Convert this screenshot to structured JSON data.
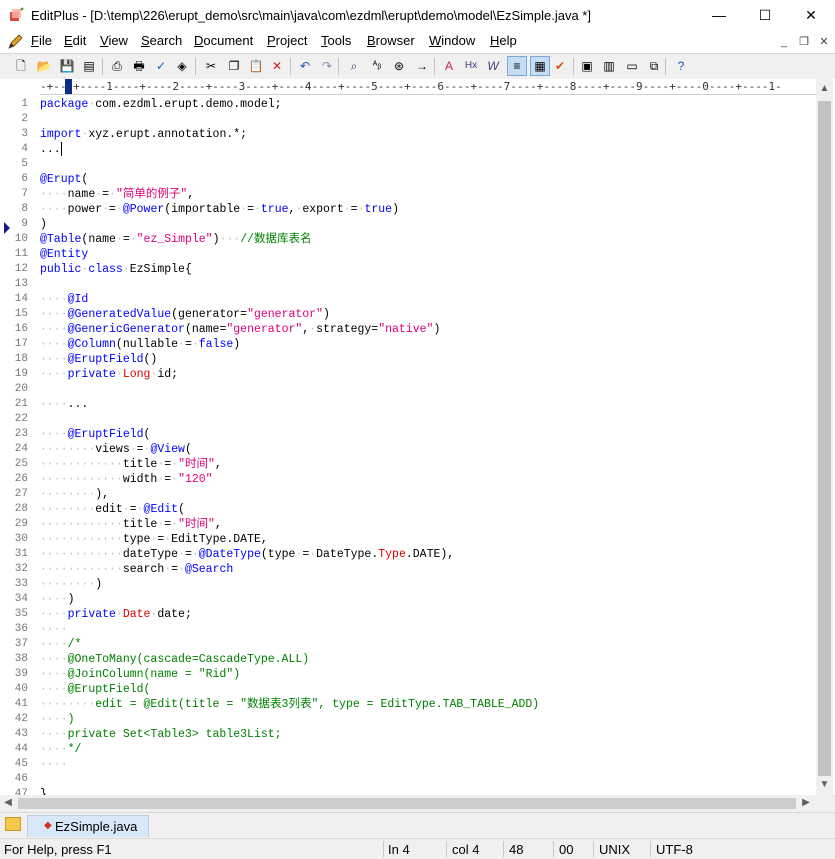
{
  "window": {
    "title": "EditPlus - [D:\\temp\\226\\erupt_demo\\src\\main\\java\\com\\ezdml\\erupt\\demo\\model\\EzSimple.java *]",
    "minimize_glyph": "—",
    "maximize_glyph": "☐",
    "close_glyph": "✕"
  },
  "menu": {
    "items": [
      {
        "hot": "F",
        "rest": "ile"
      },
      {
        "hot": "E",
        "rest": "dit"
      },
      {
        "hot": "V",
        "rest": "iew"
      },
      {
        "hot": "S",
        "rest": "earch"
      },
      {
        "hot": "D",
        "rest": "ocument"
      },
      {
        "hot": "P",
        "rest": "roject"
      },
      {
        "hot": "T",
        "rest": "ools"
      },
      {
        "hot": "B",
        "rest": "rowser"
      },
      {
        "hot": "W",
        "rest": "indow"
      },
      {
        "hot": "H",
        "rest": "elp"
      }
    ],
    "mdi_minimize": "_",
    "mdi_restore": "❐",
    "mdi_close": "✕"
  },
  "toolbar": {
    "icons": [
      "new-file-icon",
      "open-file-icon",
      "save-icon",
      "save-all-icon",
      "print-preview-icon",
      "print-icon",
      "spell-check-icon",
      "browser-preview-icon",
      "cut-icon",
      "copy-icon",
      "paste-icon",
      "delete-icon",
      "undo-icon",
      "redo-icon",
      "find-icon",
      "replace-icon",
      "find-in-files-icon",
      "go-to-icon",
      "font-icon",
      "hx-icon",
      "word-wrap-w-icon",
      "wrap-icon",
      "column-select-icon",
      "check-icon",
      "cliptext-icon",
      "directory-icon",
      "output-window-icon",
      "toggle-window-icon",
      "context-help-icon"
    ],
    "active": [
      "wrap-icon",
      "column-select-icon"
    ]
  },
  "editor": {
    "ruler": "-+---+----1----+----2----+----3----+----4----+----5----+----6----+----7----+----8----+----9----+----0----+----1-",
    "current_line": 4,
    "line_numbers": [
      "1",
      "2",
      "3",
      "4",
      "5",
      "6",
      "7",
      "8",
      "9",
      "10",
      "11",
      "12",
      "13",
      "14",
      "15",
      "16",
      "17",
      "18",
      "19",
      "20",
      "21",
      "22",
      "23",
      "24",
      "25",
      "26",
      "27",
      "28",
      "29",
      "30",
      "31",
      "32",
      "33",
      "34",
      "35",
      "36",
      "37",
      "38",
      "39",
      "40",
      "41",
      "42",
      "43",
      "44",
      "45",
      "46",
      "47"
    ],
    "lines": [
      [
        [
          "k",
          "package"
        ],
        [
          "d",
          "·"
        ],
        [
          "",
          "com.ezdml.erupt.demo.model;"
        ]
      ],
      [],
      [
        [
          "k",
          "import"
        ],
        [
          "d",
          "·"
        ],
        [
          "",
          "xyz.erupt.annotation.*;"
        ]
      ],
      [
        [
          "",
          "..."
        ],
        [
          "caret",
          ""
        ]
      ],
      [],
      [
        [
          "a",
          "@Erupt"
        ],
        [
          "",
          "("
        ]
      ],
      [
        [
          "d",
          "····"
        ],
        [
          "",
          "name"
        ],
        [
          "d",
          "·"
        ],
        [
          "",
          "="
        ],
        [
          "d",
          "·"
        ],
        [
          "s",
          "\"简单的例子\""
        ],
        [
          "",
          ","
        ]
      ],
      [
        [
          "d",
          "····"
        ],
        [
          "",
          "power"
        ],
        [
          "d",
          "·"
        ],
        [
          "",
          "="
        ],
        [
          "d",
          "·"
        ],
        [
          "a",
          "@Power"
        ],
        [
          "",
          "(importable"
        ],
        [
          "d",
          "·"
        ],
        [
          "",
          "="
        ],
        [
          "d",
          "·"
        ],
        [
          "k",
          "true"
        ],
        [
          "",
          ","
        ],
        [
          "d",
          "·"
        ],
        [
          "",
          "export"
        ],
        [
          "d",
          "·"
        ],
        [
          "",
          "="
        ],
        [
          "d",
          "·"
        ],
        [
          "k",
          "true"
        ],
        [
          "",
          ")"
        ]
      ],
      [
        [
          "",
          ")"
        ]
      ],
      [
        [
          "a",
          "@Table"
        ],
        [
          "",
          "(name"
        ],
        [
          "d",
          "·"
        ],
        [
          "",
          "="
        ],
        [
          "d",
          "·"
        ],
        [
          "s",
          "\"ez_Simple\""
        ],
        [
          "",
          ")"
        ],
        [
          "d",
          "···"
        ],
        [
          "c",
          "//数据库表名"
        ]
      ],
      [
        [
          "a",
          "@Entity"
        ]
      ],
      [
        [
          "k",
          "public"
        ],
        [
          "d",
          "·"
        ],
        [
          "k",
          "class"
        ],
        [
          "d",
          "·"
        ],
        [
          "",
          "EzSimple{"
        ]
      ],
      [],
      [
        [
          "d",
          "····"
        ],
        [
          "a",
          "@Id"
        ]
      ],
      [
        [
          "d",
          "····"
        ],
        [
          "a",
          "@GeneratedValue"
        ],
        [
          "",
          "(generator="
        ],
        [
          "s",
          "\"generator\""
        ],
        [
          "",
          ")"
        ]
      ],
      [
        [
          "d",
          "····"
        ],
        [
          "a",
          "@GenericGenerator"
        ],
        [
          "",
          "(name="
        ],
        [
          "s",
          "\"generator\""
        ],
        [
          "",
          ","
        ],
        [
          "d",
          "·"
        ],
        [
          "",
          "strategy="
        ],
        [
          "s",
          "\"native\""
        ],
        [
          "",
          ")"
        ]
      ],
      [
        [
          "d",
          "····"
        ],
        [
          "a",
          "@Column"
        ],
        [
          "",
          "(nullable"
        ],
        [
          "d",
          "·"
        ],
        [
          "",
          "="
        ],
        [
          "d",
          "·"
        ],
        [
          "k",
          "false"
        ],
        [
          "",
          ")"
        ]
      ],
      [
        [
          "d",
          "····"
        ],
        [
          "a",
          "@EruptField"
        ],
        [
          "",
          "()"
        ]
      ],
      [
        [
          "d",
          "····"
        ],
        [
          "k",
          "private"
        ],
        [
          "d",
          "·"
        ],
        [
          "t",
          "Long"
        ],
        [
          "d",
          "·"
        ],
        [
          "",
          "id;"
        ]
      ],
      [],
      [
        [
          "d",
          "····"
        ],
        [
          "",
          "..."
        ]
      ],
      [],
      [
        [
          "d",
          "····"
        ],
        [
          "a",
          "@EruptField"
        ],
        [
          "",
          "("
        ]
      ],
      [
        [
          "d",
          "········"
        ],
        [
          "",
          "views"
        ],
        [
          "d",
          "·"
        ],
        [
          "",
          "="
        ],
        [
          "d",
          "·"
        ],
        [
          "a",
          "@View"
        ],
        [
          "",
          "("
        ]
      ],
      [
        [
          "d",
          "············"
        ],
        [
          "",
          "title"
        ],
        [
          "d",
          "·"
        ],
        [
          "",
          "="
        ],
        [
          "d",
          "·"
        ],
        [
          "s",
          "\"时间\""
        ],
        [
          "",
          ","
        ]
      ],
      [
        [
          "d",
          "············"
        ],
        [
          "",
          "width"
        ],
        [
          "d",
          "·"
        ],
        [
          "",
          "="
        ],
        [
          "d",
          "·"
        ],
        [
          "s",
          "\"120\""
        ]
      ],
      [
        [
          "d",
          "········"
        ],
        [
          "",
          "),"
        ]
      ],
      [
        [
          "d",
          "········"
        ],
        [
          "",
          "edit"
        ],
        [
          "d",
          "·"
        ],
        [
          "",
          "="
        ],
        [
          "d",
          "·"
        ],
        [
          "a",
          "@Edit"
        ],
        [
          "",
          "("
        ]
      ],
      [
        [
          "d",
          "············"
        ],
        [
          "",
          "title"
        ],
        [
          "d",
          "·"
        ],
        [
          "",
          "="
        ],
        [
          "d",
          "·"
        ],
        [
          "s",
          "\"时间\""
        ],
        [
          "",
          ","
        ]
      ],
      [
        [
          "d",
          "············"
        ],
        [
          "",
          "type"
        ],
        [
          "d",
          "·"
        ],
        [
          "",
          "="
        ],
        [
          "d",
          "·"
        ],
        [
          "",
          "EditType.DATE,"
        ]
      ],
      [
        [
          "d",
          "············"
        ],
        [
          "",
          "dateType"
        ],
        [
          "d",
          "·"
        ],
        [
          "",
          "="
        ],
        [
          "d",
          "·"
        ],
        [
          "a",
          "@DateType"
        ],
        [
          "",
          "(type"
        ],
        [
          "d",
          "·"
        ],
        [
          "",
          "="
        ],
        [
          "d",
          "·"
        ],
        [
          "",
          "DateType."
        ],
        [
          "t",
          "Type"
        ],
        [
          "",
          ".DATE),"
        ]
      ],
      [
        [
          "d",
          "············"
        ],
        [
          "",
          "search"
        ],
        [
          "d",
          "·"
        ],
        [
          "",
          "="
        ],
        [
          "d",
          "·"
        ],
        [
          "a",
          "@Search"
        ]
      ],
      [
        [
          "d",
          "········"
        ],
        [
          "",
          ")"
        ]
      ],
      [
        [
          "d",
          "····"
        ],
        [
          "",
          ")"
        ]
      ],
      [
        [
          "d",
          "····"
        ],
        [
          "k",
          "private"
        ],
        [
          "d",
          "·"
        ],
        [
          "t",
          "Date"
        ],
        [
          "d",
          "·"
        ],
        [
          "",
          "date;"
        ]
      ],
      [
        [
          "d",
          "····"
        ]
      ],
      [
        [
          "d",
          "····"
        ],
        [
          "c",
          "/*"
        ]
      ],
      [
        [
          "d",
          "····"
        ],
        [
          "c",
          "@OneToMany(cascade=CascadeType.ALL)"
        ]
      ],
      [
        [
          "d",
          "····"
        ],
        [
          "c",
          "@JoinColumn(name = \"Rid\")"
        ]
      ],
      [
        [
          "d",
          "····"
        ],
        [
          "c",
          "@EruptField("
        ]
      ],
      [
        [
          "d",
          "········"
        ],
        [
          "c",
          "edit = @Edit(title = \"数据表3列表\", type = EditType.TAB_TABLE_ADD)"
        ]
      ],
      [
        [
          "d",
          "····"
        ],
        [
          "c",
          ")"
        ]
      ],
      [
        [
          "d",
          "····"
        ],
        [
          "c",
          "private Set<Table3> table3List;"
        ]
      ],
      [
        [
          "d",
          "····"
        ],
        [
          "c",
          "*/"
        ]
      ],
      [
        [
          "d",
          "····"
        ]
      ],
      [],
      [
        [
          "",
          "}"
        ]
      ]
    ]
  },
  "tabs": [
    {
      "label": "EzSimple.java",
      "modified_marker": "◆"
    }
  ],
  "status": {
    "help": "For Help, press F1",
    "line": "In 4",
    "col": "col 4",
    "num1": "48",
    "num2": "00",
    "eol": "UNIX",
    "encoding": "UTF-8"
  }
}
